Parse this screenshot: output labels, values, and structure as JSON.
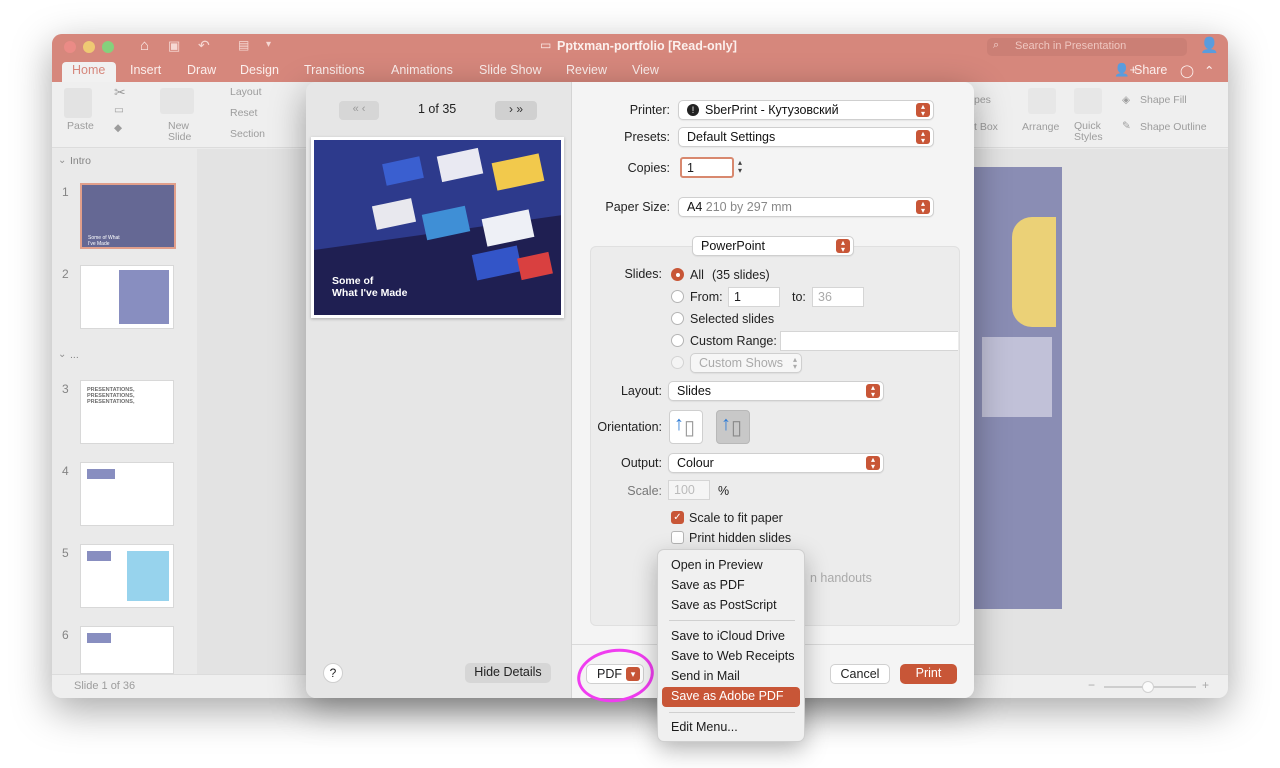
{
  "window": {
    "title": "Pptxman-portfolio [Read-only]",
    "search_placeholder": "Search in Presentation"
  },
  "ribbon": {
    "tabs": [
      "Home",
      "Insert",
      "Draw",
      "Design",
      "Transitions",
      "Animations",
      "Slide Show",
      "Review",
      "View"
    ],
    "share": "Share",
    "groups": {
      "paste": "Paste",
      "new_slide_1": "New",
      "new_slide_2": "Slide",
      "layout": "Layout",
      "reset": "Reset",
      "section": "Section",
      "shapes": "pes",
      "text_box": "t Box",
      "arrange": "Arrange",
      "quick_styles_1": "Quick",
      "quick_styles_2": "Styles",
      "shape_fill": "Shape Fill",
      "shape_outline": "Shape Outline"
    }
  },
  "sidebar": {
    "section_intro": "Intro",
    "section_more": "...",
    "slides": [
      "1",
      "2",
      "3",
      "4",
      "5",
      "6"
    ],
    "slide1_text": "Some of What I've Made",
    "slide3_text": "PRESENTATIONS, PRESENTATIONS, PRESENTATIONS,"
  },
  "status": {
    "slide_count": "Slide 1 of 36"
  },
  "dialog": {
    "preview": {
      "page": "1 of 35",
      "slide_caption_1": "Some of",
      "slide_caption_2": "What I've Made"
    },
    "printer_label": "Printer:",
    "printer_value": "SberPrint - Кутузовский",
    "presets_label": "Presets:",
    "presets_value": "Default Settings",
    "copies_label": "Copies:",
    "copies_value": "1",
    "paper_label": "Paper Size:",
    "paper_value": "A4",
    "paper_dims": "210 by 297 mm",
    "app_section": "PowerPoint",
    "slides_label": "Slides:",
    "all_label": "All",
    "all_count": "(35 slides)",
    "from_label": "From:",
    "from_value": "1",
    "to_label": "to:",
    "to_value": "36",
    "selected_slides": "Selected slides",
    "custom_range": "Custom Range:",
    "custom_shows": "Custom Shows",
    "layout_label": "Layout:",
    "layout_value": "Slides",
    "orientation_label": "Orientation:",
    "output_label": "Output:",
    "output_value": "Colour",
    "scale_label": "Scale:",
    "scale_value": "100",
    "scale_unit": "%",
    "scale_to_fit": "Scale to fit paper",
    "print_hidden": "Print hidden slides",
    "handouts_fragment": "n handouts",
    "help": "?",
    "hide_details": "Hide Details",
    "pdf": "PDF",
    "cancel": "Cancel",
    "print": "Print"
  },
  "pdf_menu": {
    "items_group1": [
      "Open in Preview",
      "Save as PDF",
      "Save as PostScript"
    ],
    "items_group2": [
      "Save to iCloud Drive",
      "Save to Web Receipts",
      "Send in Mail",
      "Save as Adobe PDF"
    ],
    "edit_menu": "Edit Menu..."
  },
  "colors": {
    "accent": "#c85637",
    "titlebar": "#c6594a",
    "highlight_circle": "#f03df0"
  }
}
